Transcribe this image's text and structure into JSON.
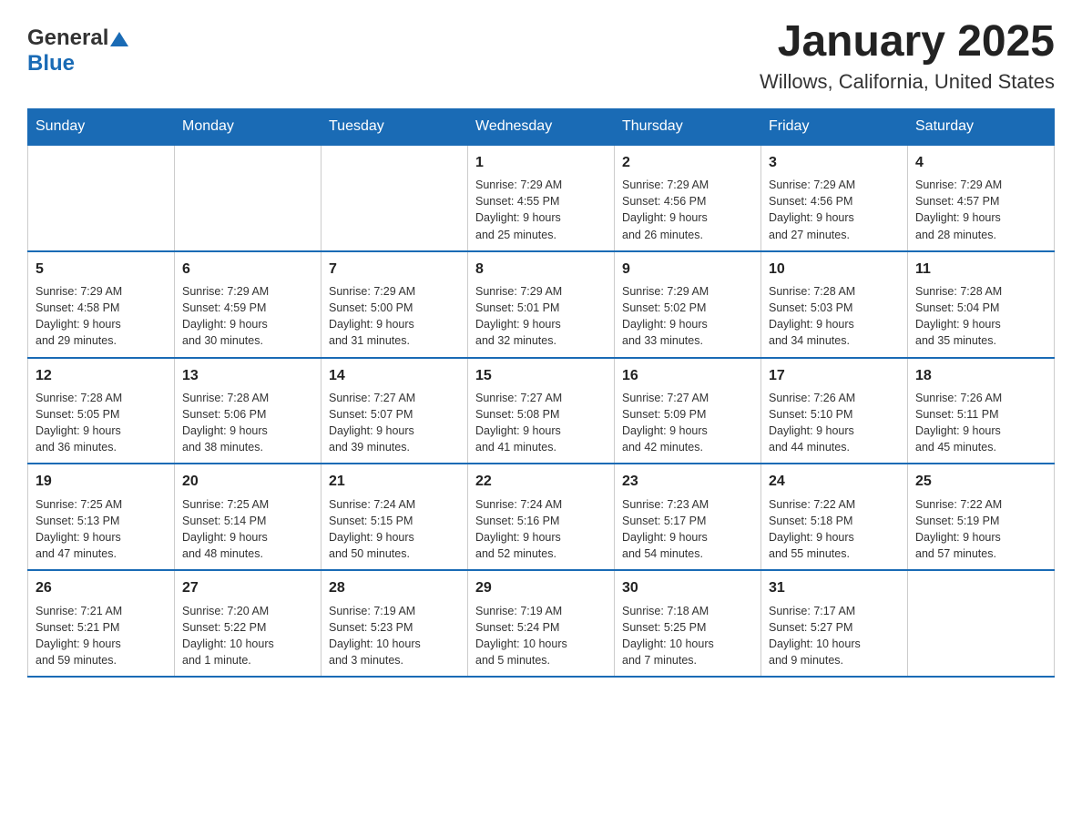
{
  "header": {
    "logo_text_general": "General",
    "logo_text_blue": "Blue",
    "title": "January 2025",
    "subtitle": "Willows, California, United States"
  },
  "days_of_week": [
    "Sunday",
    "Monday",
    "Tuesday",
    "Wednesday",
    "Thursday",
    "Friday",
    "Saturday"
  ],
  "weeks": [
    [
      {
        "day": "",
        "info": ""
      },
      {
        "day": "",
        "info": ""
      },
      {
        "day": "",
        "info": ""
      },
      {
        "day": "1",
        "info": "Sunrise: 7:29 AM\nSunset: 4:55 PM\nDaylight: 9 hours\nand 25 minutes."
      },
      {
        "day": "2",
        "info": "Sunrise: 7:29 AM\nSunset: 4:56 PM\nDaylight: 9 hours\nand 26 minutes."
      },
      {
        "day": "3",
        "info": "Sunrise: 7:29 AM\nSunset: 4:56 PM\nDaylight: 9 hours\nand 27 minutes."
      },
      {
        "day": "4",
        "info": "Sunrise: 7:29 AM\nSunset: 4:57 PM\nDaylight: 9 hours\nand 28 minutes."
      }
    ],
    [
      {
        "day": "5",
        "info": "Sunrise: 7:29 AM\nSunset: 4:58 PM\nDaylight: 9 hours\nand 29 minutes."
      },
      {
        "day": "6",
        "info": "Sunrise: 7:29 AM\nSunset: 4:59 PM\nDaylight: 9 hours\nand 30 minutes."
      },
      {
        "day": "7",
        "info": "Sunrise: 7:29 AM\nSunset: 5:00 PM\nDaylight: 9 hours\nand 31 minutes."
      },
      {
        "day": "8",
        "info": "Sunrise: 7:29 AM\nSunset: 5:01 PM\nDaylight: 9 hours\nand 32 minutes."
      },
      {
        "day": "9",
        "info": "Sunrise: 7:29 AM\nSunset: 5:02 PM\nDaylight: 9 hours\nand 33 minutes."
      },
      {
        "day": "10",
        "info": "Sunrise: 7:28 AM\nSunset: 5:03 PM\nDaylight: 9 hours\nand 34 minutes."
      },
      {
        "day": "11",
        "info": "Sunrise: 7:28 AM\nSunset: 5:04 PM\nDaylight: 9 hours\nand 35 minutes."
      }
    ],
    [
      {
        "day": "12",
        "info": "Sunrise: 7:28 AM\nSunset: 5:05 PM\nDaylight: 9 hours\nand 36 minutes."
      },
      {
        "day": "13",
        "info": "Sunrise: 7:28 AM\nSunset: 5:06 PM\nDaylight: 9 hours\nand 38 minutes."
      },
      {
        "day": "14",
        "info": "Sunrise: 7:27 AM\nSunset: 5:07 PM\nDaylight: 9 hours\nand 39 minutes."
      },
      {
        "day": "15",
        "info": "Sunrise: 7:27 AM\nSunset: 5:08 PM\nDaylight: 9 hours\nand 41 minutes."
      },
      {
        "day": "16",
        "info": "Sunrise: 7:27 AM\nSunset: 5:09 PM\nDaylight: 9 hours\nand 42 minutes."
      },
      {
        "day": "17",
        "info": "Sunrise: 7:26 AM\nSunset: 5:10 PM\nDaylight: 9 hours\nand 44 minutes."
      },
      {
        "day": "18",
        "info": "Sunrise: 7:26 AM\nSunset: 5:11 PM\nDaylight: 9 hours\nand 45 minutes."
      }
    ],
    [
      {
        "day": "19",
        "info": "Sunrise: 7:25 AM\nSunset: 5:13 PM\nDaylight: 9 hours\nand 47 minutes."
      },
      {
        "day": "20",
        "info": "Sunrise: 7:25 AM\nSunset: 5:14 PM\nDaylight: 9 hours\nand 48 minutes."
      },
      {
        "day": "21",
        "info": "Sunrise: 7:24 AM\nSunset: 5:15 PM\nDaylight: 9 hours\nand 50 minutes."
      },
      {
        "day": "22",
        "info": "Sunrise: 7:24 AM\nSunset: 5:16 PM\nDaylight: 9 hours\nand 52 minutes."
      },
      {
        "day": "23",
        "info": "Sunrise: 7:23 AM\nSunset: 5:17 PM\nDaylight: 9 hours\nand 54 minutes."
      },
      {
        "day": "24",
        "info": "Sunrise: 7:22 AM\nSunset: 5:18 PM\nDaylight: 9 hours\nand 55 minutes."
      },
      {
        "day": "25",
        "info": "Sunrise: 7:22 AM\nSunset: 5:19 PM\nDaylight: 9 hours\nand 57 minutes."
      }
    ],
    [
      {
        "day": "26",
        "info": "Sunrise: 7:21 AM\nSunset: 5:21 PM\nDaylight: 9 hours\nand 59 minutes."
      },
      {
        "day": "27",
        "info": "Sunrise: 7:20 AM\nSunset: 5:22 PM\nDaylight: 10 hours\nand 1 minute."
      },
      {
        "day": "28",
        "info": "Sunrise: 7:19 AM\nSunset: 5:23 PM\nDaylight: 10 hours\nand 3 minutes."
      },
      {
        "day": "29",
        "info": "Sunrise: 7:19 AM\nSunset: 5:24 PM\nDaylight: 10 hours\nand 5 minutes."
      },
      {
        "day": "30",
        "info": "Sunrise: 7:18 AM\nSunset: 5:25 PM\nDaylight: 10 hours\nand 7 minutes."
      },
      {
        "day": "31",
        "info": "Sunrise: 7:17 AM\nSunset: 5:27 PM\nDaylight: 10 hours\nand 9 minutes."
      },
      {
        "day": "",
        "info": ""
      }
    ]
  ]
}
